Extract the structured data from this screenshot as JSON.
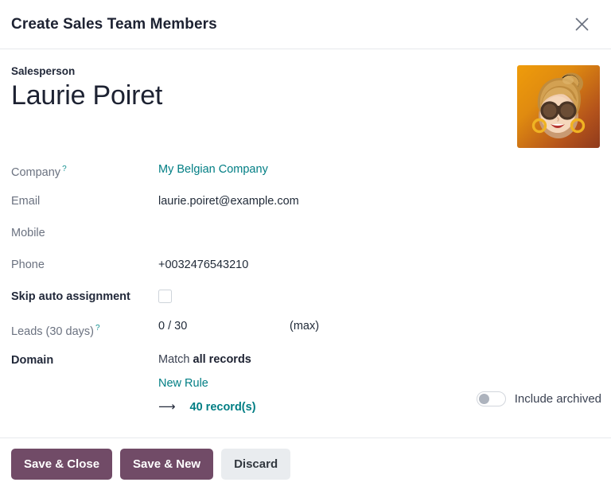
{
  "dialog": {
    "title": "Create Sales Team Members",
    "close_icon": "close-icon"
  },
  "record": {
    "type_label": "Salesperson",
    "name": "Laurie Poiret",
    "avatar_alt": "user-avatar-illustration"
  },
  "fields": {
    "company": {
      "label": "Company",
      "help_marker": "?",
      "value": "My Belgian Company"
    },
    "email": {
      "label": "Email",
      "value": "laurie.poiret@example.com"
    },
    "mobile": {
      "label": "Mobile",
      "value": ""
    },
    "phone": {
      "label": "Phone",
      "value": "+0032476543210"
    },
    "skip_auto_assignment": {
      "label": "Skip auto assignment",
      "checked": false
    },
    "leads": {
      "label": "Leads (30 days)",
      "help_marker": "?",
      "count": "0 / 30",
      "max_note": "(max)"
    },
    "domain": {
      "label": "Domain",
      "match_prefix": "Match",
      "match_value": "all records",
      "new_rule_label": "New Rule",
      "arrow_icon": "arrow-right-icon",
      "record_count": "40 record(s)",
      "include_archived_label": "Include archived",
      "include_archived_on": false
    }
  },
  "footer": {
    "save_close_label": "Save & Close",
    "save_new_label": "Save & New",
    "discard_label": "Discard"
  },
  "colors": {
    "primary": "#714b67",
    "link": "#017e84",
    "text": "#1d2232",
    "muted": "#6b7280",
    "secondary_button": "#e9ecef"
  }
}
